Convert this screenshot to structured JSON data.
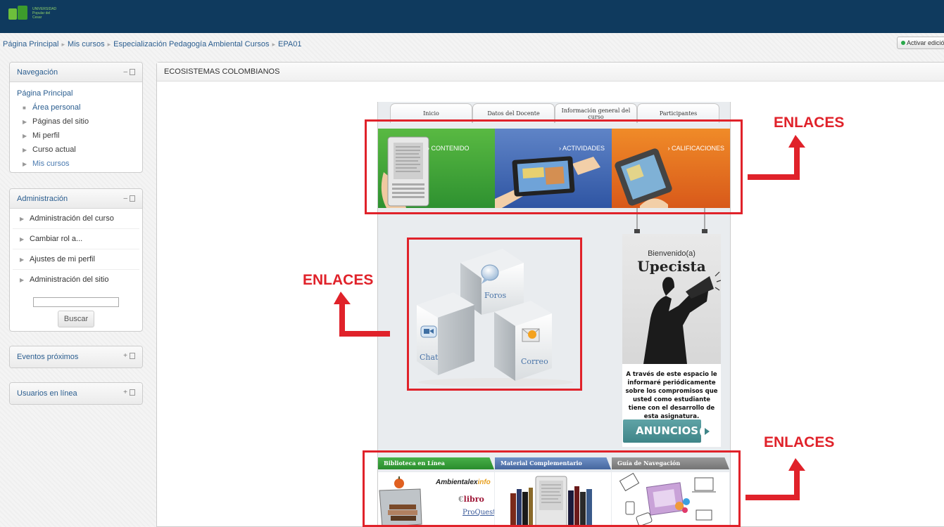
{
  "topbar": {
    "logo_text": "UNIVERSIDAD Popular del Cesar"
  },
  "breadcrumb": [
    "Página Principal",
    "Mis cursos",
    "Especialización Pedagogía Ambiental Cursos",
    "EPA01"
  ],
  "edit_button": "Activar edición",
  "navigation": {
    "title": "Navegación",
    "items": [
      {
        "label": "Página Principal"
      },
      {
        "label": "Área personal"
      },
      {
        "label": "Páginas del sitio"
      },
      {
        "label": "Mi perfil"
      },
      {
        "label": "Curso actual"
      },
      {
        "label": "Mis cursos"
      }
    ]
  },
  "administration": {
    "title": "Administración",
    "items": [
      {
        "label": "Administración del curso"
      },
      {
        "label": "Cambiar rol a..."
      },
      {
        "label": "Ajustes de mi perfil"
      },
      {
        "label": "Administración del sitio"
      }
    ],
    "search_button": "Buscar"
  },
  "events_block": {
    "title": "Eventos próximos"
  },
  "online_block": {
    "title": "Usuarios en línea"
  },
  "course": {
    "title": "ECOSISTEMAS COLOMBIANOS",
    "tabs": [
      "Inicio",
      "Datos del Docente",
      "Información general del curso",
      "Participantes"
    ],
    "banners": [
      "› CONTENIDO",
      "› ACTIVIDADES",
      "› CALIFICACIONES"
    ],
    "comm": {
      "forums": "Foros",
      "chat": "Chat",
      "mail": "Correo"
    },
    "poster": {
      "welcome_small": "Bienvenido(a)",
      "welcome_big": "Upecista",
      "text": "A través de este espacio le informaré periódicamente sobre los compromisos que usted como estudiante tiene con el desarrollo de esta asignatura.",
      "button": "ANUNCIOS"
    },
    "sections": [
      "Biblioteca en Línea",
      "Material Complementario",
      "Guía de Navegación"
    ],
    "library_logos": {
      "ambientalex": "Ambientalex",
      "ambientalex_suffix": "info",
      "elibro": "libro",
      "proquest": "ProQuest"
    }
  },
  "annotations": [
    "ENLACES",
    "ENLACES",
    "ENLACES"
  ],
  "colors": {
    "topbar": "#0f3a5e",
    "annotation_red": "#e0222a",
    "link": "#2a5d8f"
  }
}
